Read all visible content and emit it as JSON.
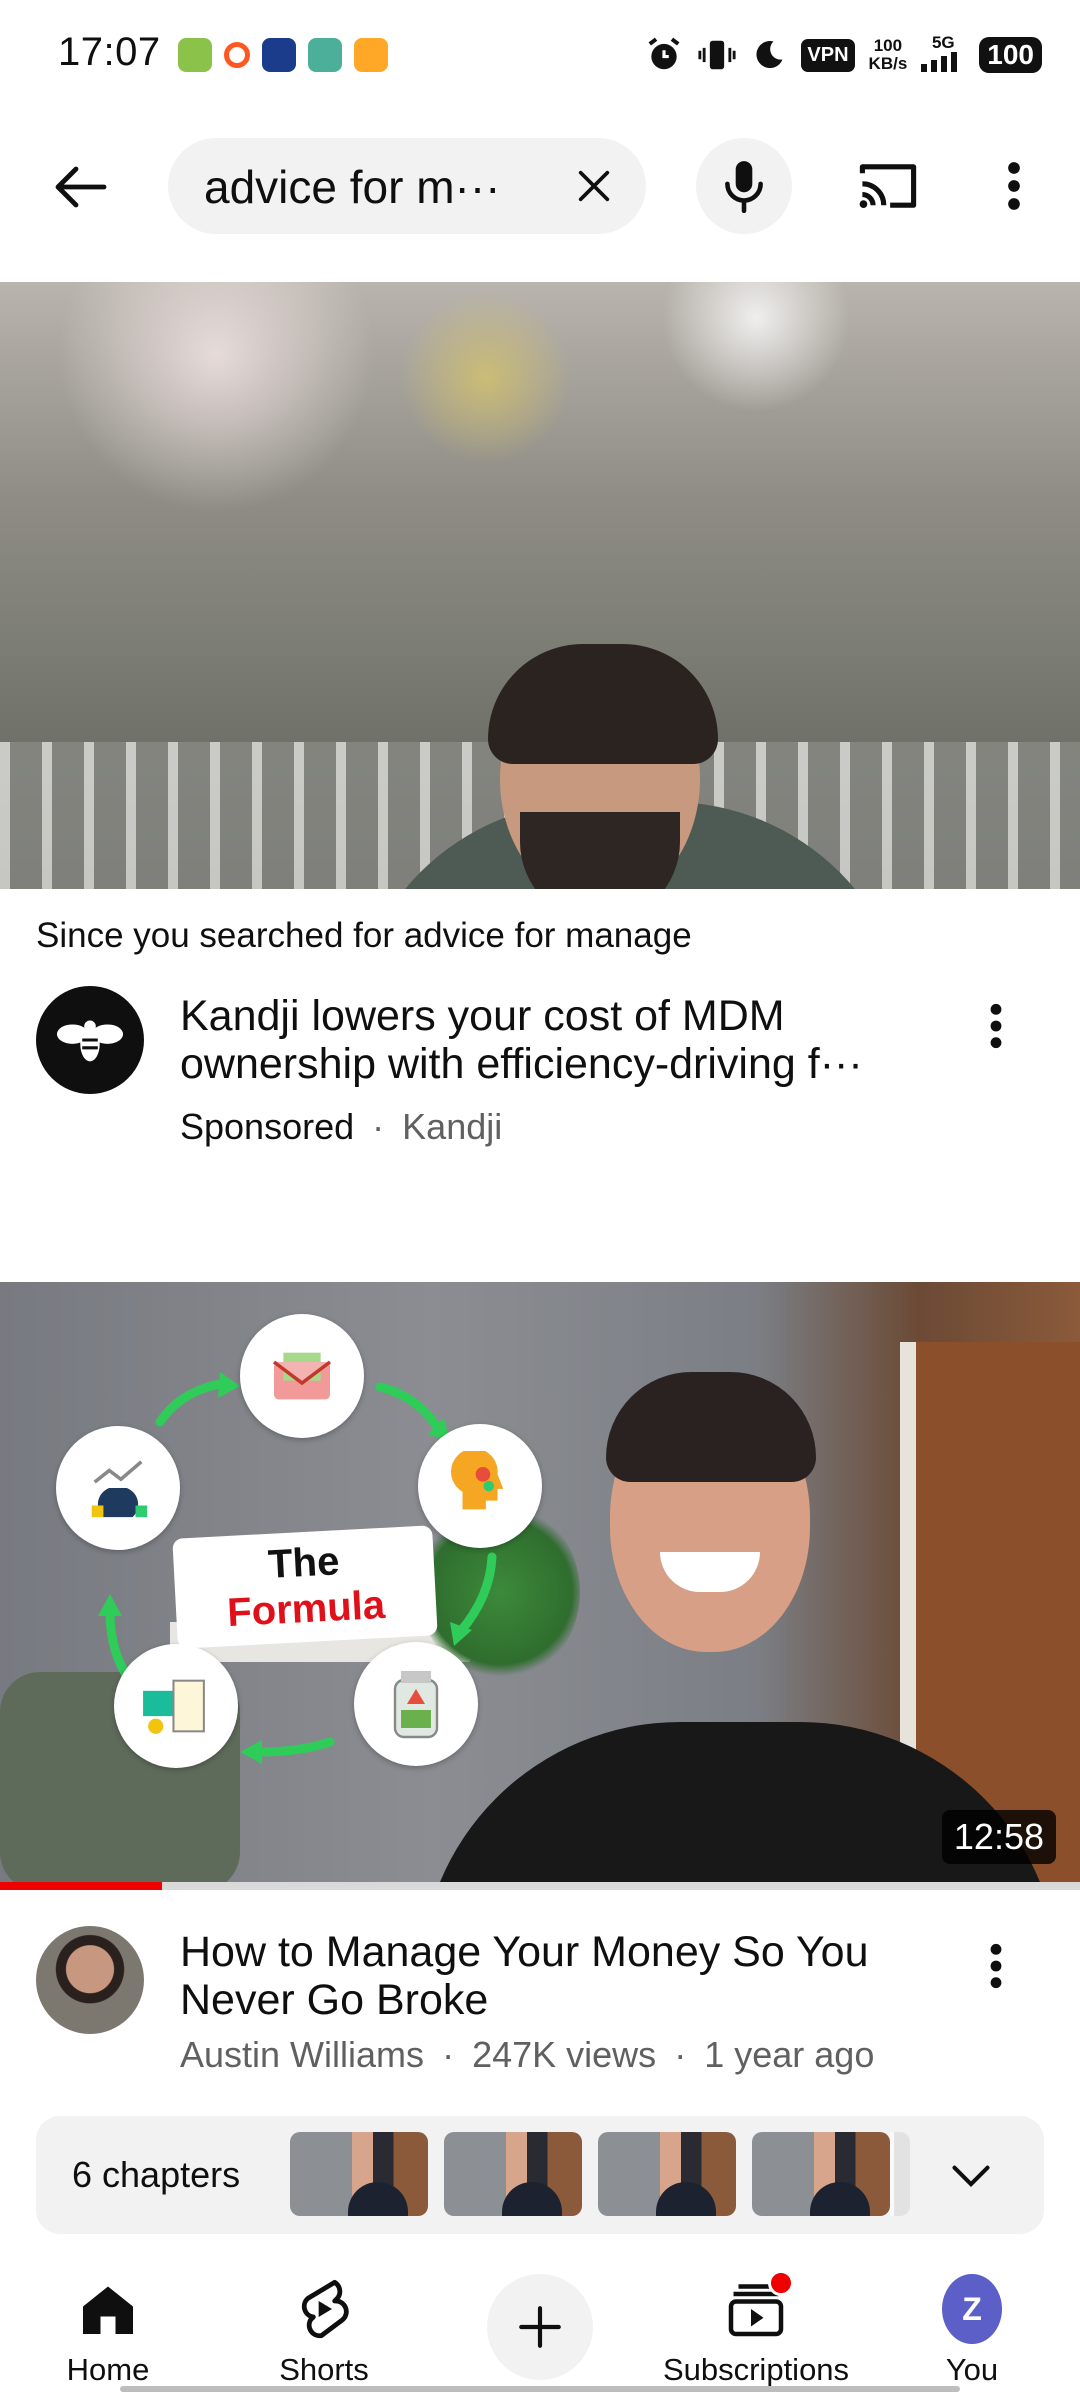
{
  "status_bar": {
    "time": "17:07",
    "vpn": "VPN",
    "speed_value": "100",
    "speed_unit": "KB/s",
    "network": "5G",
    "battery": "100",
    "icons": [
      "alarm-icon",
      "vibrate-icon",
      "dnd-moon-icon",
      "signal-icon"
    ]
  },
  "search": {
    "query": "advice for m···",
    "icons": [
      "back-arrow-icon",
      "clear-icon",
      "mic-icon",
      "cast-icon",
      "more-vert-icon"
    ]
  },
  "ad": {
    "since_prefix": "Since you searched for ",
    "since_query": "advice for manage",
    "title": "Kandji lowers your cost of MDM ownership with efficiency-driving f···",
    "sponsored": "Sponsored",
    "separator": "·",
    "advertiser": "Kandji",
    "external_link_icon": "external-link-icon"
  },
  "video": {
    "thumbnail_text_line1": "The",
    "thumbnail_text_line2": "Formula",
    "duration": "12:58",
    "watched_fraction": 0.15,
    "title": "How to Manage Your Money So You Never Go Broke",
    "channel": "Austin Williams",
    "views": "247K views",
    "age": "1 year ago",
    "separator": "·",
    "chapters_label": "6 chapters",
    "chapter_thumb_count": 4
  },
  "bottom_nav": {
    "home": "Home",
    "shorts": "Shorts",
    "subscriptions": "Subscriptions",
    "you": "You",
    "you_initial": "Z",
    "accent": "#ff0000"
  }
}
